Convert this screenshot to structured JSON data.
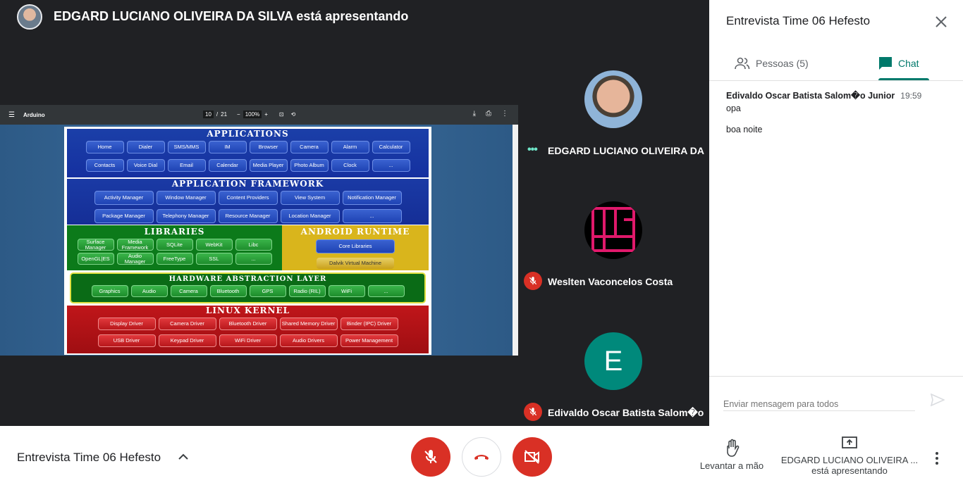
{
  "presenter": {
    "text": "EDGARD LUCIANO OLIVEIRA DA SILVA está apresentando"
  },
  "pdf": {
    "title": "Arduino",
    "page_current": "10",
    "page_total": "21",
    "zoom": "100%"
  },
  "slide": {
    "applications": {
      "title": "Applications",
      "row1": [
        "Home",
        "Dialer",
        "SMS/MMS",
        "IM",
        "Browser",
        "Camera",
        "Alarm",
        "Calculator"
      ],
      "row2": [
        "Contacts",
        "Voice Dial",
        "Email",
        "Calendar",
        "Media Player",
        "Photo Album",
        "Clock",
        "..."
      ]
    },
    "framework": {
      "title": "Application Framework",
      "row1": [
        "Activity Manager",
        "Window Manager",
        "Content Providers",
        "View System",
        "Notification Manager"
      ],
      "row2": [
        "Package Manager",
        "Telephony Manager",
        "Resource Manager",
        "Location Manager",
        "..."
      ]
    },
    "libraries": {
      "title": "Libraries",
      "row1": [
        "Surface Manager",
        "Media Framework",
        "SQLite",
        "WebKit",
        "Libc"
      ],
      "row2": [
        "OpenGL|ES",
        "Audio Manager",
        "FreeType",
        "SSL",
        "..."
      ]
    },
    "runtime": {
      "title": "Android Runtime",
      "items": [
        "Core Libraries",
        "Dalvik Virtual Machine"
      ]
    },
    "hal": {
      "title": "Hardware Abstraction Layer",
      "items": [
        "Graphics",
        "Audio",
        "Camera",
        "Bluetooth",
        "GPS",
        "Radio (RIL)",
        "WiFi",
        "..."
      ]
    },
    "kernel": {
      "title": "Linux Kernel",
      "row1": [
        "Display Driver",
        "Camera Driver",
        "Bluetooth Driver",
        "Shared Memory Driver",
        "Binder (IPC) Driver"
      ],
      "row2": [
        "USB Driver",
        "Keypad Driver",
        "WiFi Driver",
        "Audio Drivers",
        "Power Management"
      ]
    }
  },
  "tiles": [
    {
      "name": "EDGARD LUCIANO OLIVEIRA DA ...",
      "status": "speaking"
    },
    {
      "name": "Weslten Vaconcelos Costa",
      "status": "muted"
    },
    {
      "name": "Edivaldo Oscar Batista Salom�o ...",
      "status": "muted",
      "initial": "E",
      "color": "#00897b"
    }
  ],
  "panel": {
    "title": "Entrevista Time 06 Hefesto",
    "tab_people": "Pessoas (5)",
    "tab_chat": "Chat",
    "message": {
      "sender": "Edivaldo Oscar Batista Salom�o Junior",
      "time": "19:59",
      "lines": [
        "opa",
        "boa noite"
      ]
    },
    "compose_placeholder": "Enviar mensagem para todos"
  },
  "bottom": {
    "meeting_name": "Entrevista Time 06 Hefesto",
    "raise_hand": "Levantar a mão",
    "presenting_line1": "EDGARD LUCIANO OLIVEIRA ...",
    "presenting_line2": "está apresentando"
  },
  "colors": {
    "accent": "#00796b",
    "danger": "#d93025",
    "dark": "#202124"
  }
}
